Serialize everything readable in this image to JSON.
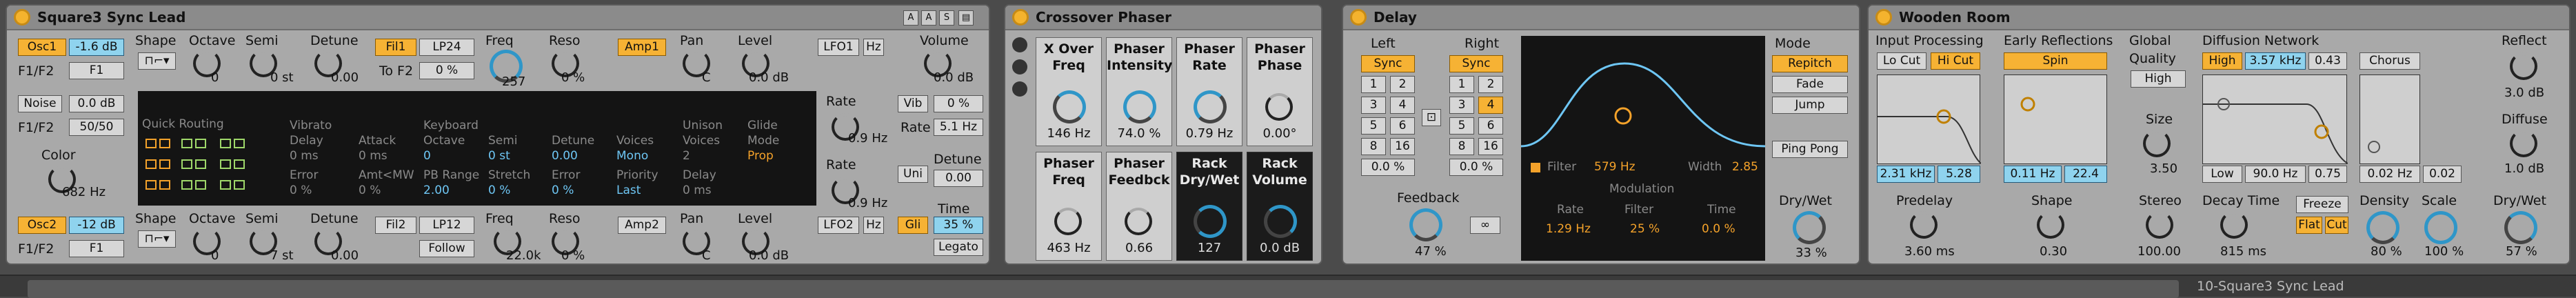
{
  "synth": {
    "title": "Square3 Sync Lead",
    "osc1": "Osc1",
    "osc1_level": "-1.6 dB",
    "f1f2_label": "F1/F2",
    "f1f2_val": "F1",
    "shape": "Shape",
    "octave": "Octave",
    "octave_val": "0",
    "semi": "Semi",
    "semi_val": "0 st",
    "detune": "Detune",
    "detune_val": "0.00",
    "fil1": "Fil1",
    "fil1_type": "LP24",
    "to_f2": "To F2",
    "to_f2_val": "0 %",
    "freq": "Freq",
    "freq_val": "257",
    "reso": "Reso",
    "reso_val": "0 %",
    "amp1": "Amp1",
    "pan": "Pan",
    "pan_val": "C",
    "level": "Level",
    "level_val": "0.0 dB",
    "lfo1": "LFO1",
    "hz": "Hz",
    "vol_label": "Volume",
    "vol_val": "0.0 dB",
    "rate": "Rate",
    "rate_val": "0.9 Hz",
    "vib": "Vib",
    "vib_val": "0 %",
    "rate2": "Rate",
    "rate2_val": "5.1 Hz",
    "noise": "Noise",
    "noise_val": "0.0 dB",
    "noise_f1f2": "50/50",
    "color": "Color",
    "color_val": "682 Hz",
    "uni": "Uni",
    "uni_val": "0.00",
    "unidet": "Detune",
    "glide_label": "Gli",
    "glide_val": "35 %",
    "time": "Time",
    "legato": "Legato",
    "osc2": "Osc2",
    "osc2_level": "-12 dB",
    "osc2_f": "F1",
    "semi2": "7 st",
    "fil2": "Fil2",
    "fil2_type": "LP12",
    "follow": "Follow",
    "freq2": "22.0k",
    "reso2": "0 %",
    "amp2": "Amp2",
    "lfo2": "LFO2",
    "rate3_val": "0.9 Hz"
  },
  "routing": {
    "quick": "Quick Routing",
    "vibrato": "Vibrato",
    "delay": "Delay",
    "delay_val": "0 ms",
    "attack": "Attack",
    "attack_val": "0 ms",
    "keyboard": "Keyboard",
    "octave": "Octave",
    "oct_val": "0",
    "semi": "Semi",
    "semi_val": "0 st",
    "detune": "Detune",
    "det_val": "0.00",
    "voices": "Voices",
    "voices_val": "Mono",
    "unison": "Unison",
    "unison2": "Voices",
    "unv": "2",
    "glide": "Glide",
    "glide_mode": "Mode",
    "glide_val": "Prop",
    "error": "Error",
    "error_val": "0 %",
    "amt": "Amt<MW",
    "amt_val": "0 %",
    "pbr": "PB Range",
    "pbr_val": "2.00",
    "stretch": "Stretch",
    "stretch_val": "0 %",
    "error2": "Error",
    "error2_val": "0 %",
    "priority": "Priority",
    "priority_val": "Last",
    "udelay": "Delay",
    "udelay_val": "0 ms"
  },
  "phaser": {
    "title": "Crossover Phaser",
    "c1": "X Over Freq",
    "c1v": "146 Hz",
    "c2": "Phaser Intensity",
    "c2v": "74.0 %",
    "c3": "Phaser Rate",
    "c3v": "0.79 Hz",
    "c4": "Phaser Phase",
    "c4v": "0.00°",
    "c5": "Phaser Freq",
    "c5v": "463 Hz",
    "c6": "Phaser Feedbck",
    "c6v": "0.66",
    "c7": "Rack Dry/Wet",
    "c7v": "127",
    "c8": "Rack Volume",
    "c8v": "0.0 dB"
  },
  "delay": {
    "title": "Delay",
    "left": "Left",
    "right": "Right",
    "sync": "Sync",
    "n1": "1",
    "n2": "2",
    "n3": "3",
    "n4": "4",
    "n5": "5",
    "n6": "6",
    "n8": "8",
    "n16": "16",
    "lpct": "0.0 %",
    "rpct": "0.0 %",
    "feedback": "Feedback",
    "fbv": "47 %",
    "filter": "Filter",
    "filterv": "579 Hz",
    "width": "Width",
    "widthv": "2.85",
    "mod": "Modulation",
    "rate": "Rate",
    "ratev": "1.29 Hz",
    "mfilter": "Filter",
    "mfilterv": "25 %",
    "mtime": "Time",
    "mtimev": "0.0 %",
    "mode": "Mode",
    "repitch": "Repitch",
    "fade": "Fade",
    "jump": "Jump",
    "pingpong": "Ping Pong",
    "drywet": "Dry/Wet",
    "dwv": "33 %"
  },
  "reverb": {
    "title": "Wooden Room",
    "inproc": "Input Processing",
    "locut": "Lo Cut",
    "hicut": "Hi Cut",
    "er": "Early Reflections",
    "spin": "Spin",
    "global": "Global",
    "quality": "Quality",
    "high": "High",
    "dn": "Diffusion Network",
    "dn_high": "High",
    "dn_freq": "3.57 kHz",
    "dn_q": "0.43",
    "chorus": "Chorus",
    "hz1": "2.31 kHz",
    "q1": "5.28",
    "sp1": "0.11 Hz",
    "sp2": "22.4",
    "size": "Size",
    "sizev": "3.50",
    "low": "Low",
    "lowf": "90.0 Hz",
    "lowq": "0.75",
    "chz": "0.02 Hz",
    "camt": "0.02",
    "reflect": "Reflect",
    "reflv": "3.0 dB",
    "diffuse": "Diffuse",
    "diffv": "1.0 dB",
    "predelay": "Predelay",
    "pdv": "3.60 ms",
    "shape": "Shape",
    "shv": "0.30",
    "stereo": "Stereo",
    "stv": "100.00",
    "decay": "Decay Time",
    "dcv": "815 ms",
    "freeze": "Freeze",
    "flat": "Flat",
    "cut": "Cut",
    "density": "Density",
    "denv": "80 %",
    "scale": "Scale",
    "scv": "100 %",
    "drywet": "Dry/Wet",
    "dwv": "57 %"
  },
  "footer": {
    "clip": "10-Square3 Sync Lead"
  },
  "colors": {
    "accent_orange": "#f6b234",
    "accent_blue": "#8fd3ee"
  }
}
